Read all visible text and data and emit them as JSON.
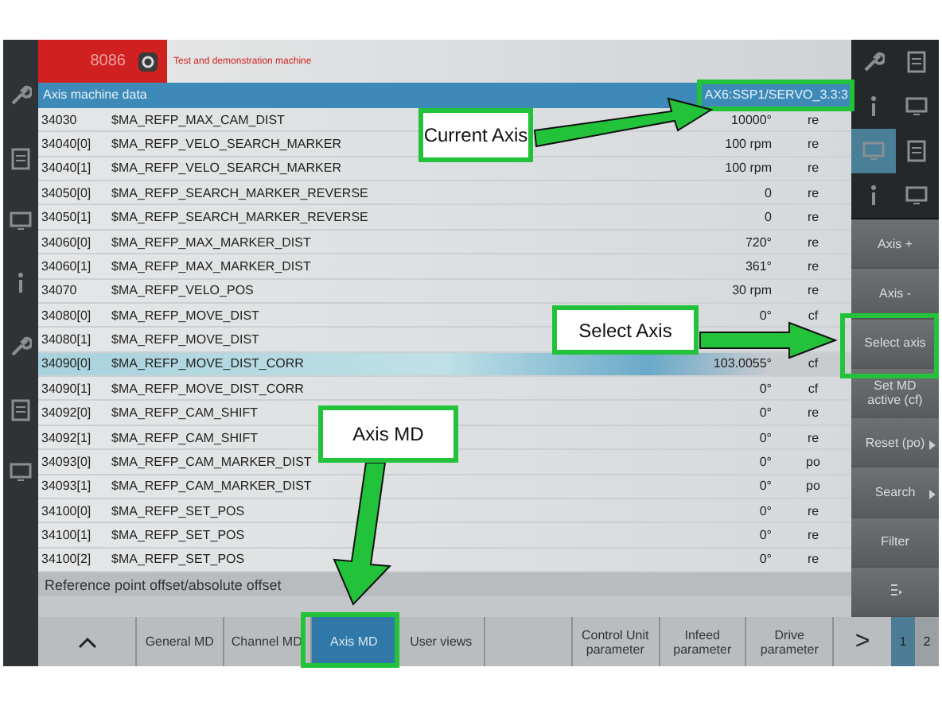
{
  "header": {
    "number": "8086",
    "machine": "Test and demonstration machine"
  },
  "title_bar": {
    "title": "Axis machine data",
    "axis": "AX6:SSP1/SERVO_3.3:3"
  },
  "table": {
    "rows": [
      {
        "number": "34030",
        "name": "$MA_REFP_MAX_CAM_DIST",
        "value": "10000°",
        "unit": "re",
        "selected": false
      },
      {
        "number": "34040[0]",
        "name": "$MA_REFP_VELO_SEARCH_MARKER",
        "value": "100 rpm",
        "unit": "re",
        "selected": false
      },
      {
        "number": "34040[1]",
        "name": "$MA_REFP_VELO_SEARCH_MARKER",
        "value": "100 rpm",
        "unit": "re",
        "selected": false
      },
      {
        "number": "34050[0]",
        "name": "$MA_REFP_SEARCH_MARKER_REVERSE",
        "value": "0",
        "unit": "re",
        "selected": false
      },
      {
        "number": "34050[1]",
        "name": "$MA_REFP_SEARCH_MARKER_REVERSE",
        "value": "0",
        "unit": "re",
        "selected": false
      },
      {
        "number": "34060[0]",
        "name": "$MA_REFP_MAX_MARKER_DIST",
        "value": "720°",
        "unit": "re",
        "selected": false
      },
      {
        "number": "34060[1]",
        "name": "$MA_REFP_MAX_MARKER_DIST",
        "value": "361°",
        "unit": "re",
        "selected": false
      },
      {
        "number": "34070",
        "name": "$MA_REFP_VELO_POS",
        "value": "30 rpm",
        "unit": "re",
        "selected": false
      },
      {
        "number": "34080[0]",
        "name": "$MA_REFP_MOVE_DIST",
        "value": "0°",
        "unit": "cf",
        "selected": false
      },
      {
        "number": "34080[1]",
        "name": "$MA_REFP_MOVE_DIST",
        "selected": false
      },
      {
        "number": "34090[0]",
        "name": "$MA_REFP_MOVE_DIST_CORR",
        "value": "103.0055°",
        "unit": "cf",
        "selected": true
      },
      {
        "number": "34090[1]",
        "name": "$MA_REFP_MOVE_DIST_CORR",
        "value": "0°",
        "unit": "cf",
        "selected": false
      },
      {
        "number": "34092[0]",
        "name": "$MA_REFP_CAM_SHIFT",
        "value": "0°",
        "unit": "re",
        "selected": false
      },
      {
        "number": "34092[1]",
        "name": "$MA_REFP_CAM_SHIFT",
        "value": "0°",
        "unit": "re",
        "selected": false
      },
      {
        "number": "34093[0]",
        "name": "$MA_REFP_CAM_MARKER_DIST",
        "value": "0°",
        "unit": "po",
        "selected": false
      },
      {
        "number": "34093[1]",
        "name": "$MA_REFP_CAM_MARKER_DIST",
        "value": "0°",
        "unit": "po",
        "selected": false
      },
      {
        "number": "34100[0]",
        "name": "$MA_REFP_SET_POS",
        "value": "0°",
        "unit": "re",
        "selected": false
      },
      {
        "number": "34100[1]",
        "name": "$MA_REFP_SET_POS",
        "value": "0°",
        "unit": "re",
        "selected": false
      },
      {
        "number": "34100[2]",
        "name": "$MA_REFP_SET_POS",
        "value": "0°",
        "unit": "re",
        "selected": false
      }
    ]
  },
  "status_line": "Reference point offset/absolute offset",
  "side_softkeys": [
    {
      "label": "Axis +",
      "more": false
    },
    {
      "label": "Axis -",
      "more": false
    },
    {
      "label": "Select axis",
      "more": false
    },
    {
      "label": "Set MD active (cf)",
      "more": false
    },
    {
      "label": "Reset (po)",
      "more": true
    },
    {
      "label": "Search",
      "more": true
    },
    {
      "label": "Filter",
      "more": false
    }
  ],
  "bottom_softkeys": [
    {
      "label": "General MD",
      "selected": false
    },
    {
      "label": "Channel MD",
      "selected": false
    },
    {
      "label": "Axis MD",
      "selected": true
    },
    {
      "label": "User views",
      "selected": false
    },
    {
      "selected": false
    },
    {
      "label": "Control Unit parameter",
      "selected": false
    },
    {
      "label": "Infeed parameter",
      "selected": false
    },
    {
      "label": "Drive parameter",
      "selected": false
    }
  ],
  "next_key": ">",
  "pages": [
    {
      "label": "1",
      "selected": true
    },
    {
      "label": "2",
      "selected": false
    }
  ],
  "callouts": [
    {
      "text": "Current Axis"
    },
    {
      "text": "Select Axis"
    },
    {
      "text": "Axis MD"
    }
  ]
}
